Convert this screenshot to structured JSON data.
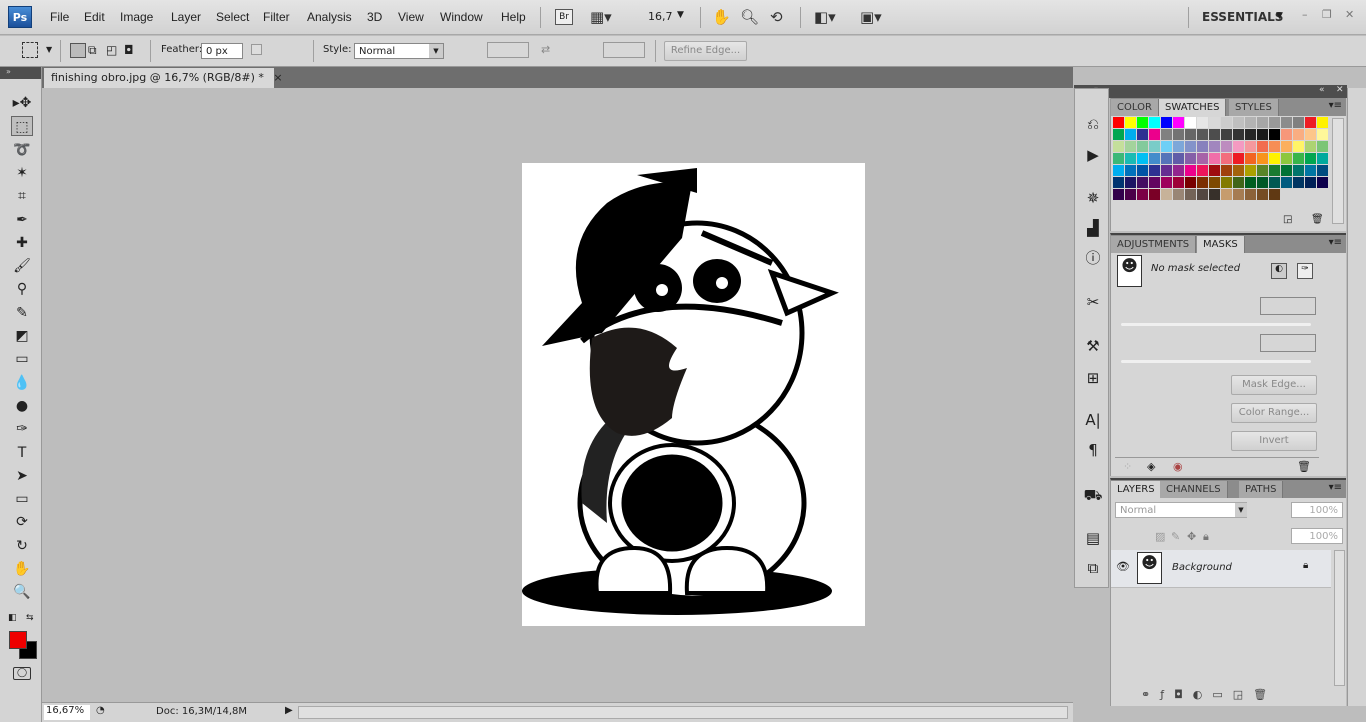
{
  "app": {
    "logo": "Ps",
    "menu": [
      "File",
      "Edit",
      "Image",
      "Layer",
      "Select",
      "Filter",
      "Analysis",
      "3D",
      "View",
      "Window",
      "Help"
    ],
    "bridge": "Br",
    "zoom": "16,7",
    "workspace": "ESSENTIALS",
    "window_controls": {
      "minimize": "–",
      "restore": "❐",
      "close": "✕"
    }
  },
  "options": {
    "feather_label": "Feather:",
    "feather_value": "0 px",
    "style_label": "Style:",
    "style_value": "Normal",
    "refine_edge": "Refine Edge..."
  },
  "document": {
    "tab_title": "finishing obro.jpg @ 16,7% (RGB/8#) *",
    "close": "×"
  },
  "tools": [
    {
      "name": "move-tool",
      "glyph": "▸✥"
    },
    {
      "name": "rectangular-marquee-tool",
      "glyph": "⬚",
      "selected": true
    },
    {
      "name": "lasso-tool",
      "glyph": "➰"
    },
    {
      "name": "magic-wand-tool",
      "glyph": "✶"
    },
    {
      "name": "crop-tool",
      "glyph": "⌗"
    },
    {
      "name": "eyedropper-tool",
      "glyph": "✒"
    },
    {
      "name": "healing-brush-tool",
      "glyph": "✚"
    },
    {
      "name": "brush-tool",
      "glyph": "🖌"
    },
    {
      "name": "clone-stamp-tool",
      "glyph": "⚲"
    },
    {
      "name": "history-brush-tool",
      "glyph": "✎"
    },
    {
      "name": "eraser-tool",
      "glyph": "◩"
    },
    {
      "name": "gradient-tool",
      "glyph": "▭"
    },
    {
      "name": "blur-tool",
      "glyph": "💧"
    },
    {
      "name": "dodge-tool",
      "glyph": "●"
    },
    {
      "name": "pen-tool",
      "glyph": "✑"
    },
    {
      "name": "type-tool",
      "glyph": "T"
    },
    {
      "name": "path-selection-tool",
      "glyph": "➤"
    },
    {
      "name": "rectangle-tool",
      "glyph": "▭"
    },
    {
      "name": "3d-rotate-tool",
      "glyph": "⟳"
    },
    {
      "name": "3d-orbit-tool",
      "glyph": "↻"
    },
    {
      "name": "hand-tool",
      "glyph": "✋"
    },
    {
      "name": "zoom-tool",
      "glyph": "🔍"
    }
  ],
  "colors": {
    "foreground": "#ee0000",
    "background": "#000000"
  },
  "panels": {
    "swatches_tabs": [
      "COLOR",
      "SWATCHES",
      "STYLES"
    ],
    "swatches": [
      [
        "#ff0000",
        "#ffff00",
        "#00ff00",
        "#00ffff",
        "#0000ff",
        "#ff00ff",
        "#ffffff",
        "#e6e6e6",
        "#d9d9d9",
        "#cccccc",
        "#bfbfbf",
        "#b3b3b3",
        "#a6a6a6",
        "#999999",
        "#8c8c8c",
        "#808080",
        "#ed1c24",
        "#fff200"
      ],
      [
        "#00a651",
        "#00aeef",
        "#2e3192",
        "#ec008c",
        "#808080",
        "#737373",
        "#666666",
        "#595959",
        "#4d4d4d",
        "#404040",
        "#333333",
        "#262626",
        "#1a1a1a",
        "#000000",
        "#f7977a",
        "#f9ad81",
        "#fdc68a",
        "#fff79a"
      ],
      [
        "#c4df9b",
        "#a3d39c",
        "#82ca9c",
        "#7accc8",
        "#6dcff6",
        "#7da7d9",
        "#8393ca",
        "#8781bd",
        "#a186be",
        "#bd8cbf",
        "#f49ac1",
        "#f5989d",
        "#f26c4f",
        "#f68e55",
        "#fbaf5d",
        "#fff467",
        "#acd372",
        "#7cc576"
      ],
      [
        "#3bb878",
        "#1abbb4",
        "#00bff3",
        "#438ccb",
        "#5574b9",
        "#605ca8",
        "#855fa8",
        "#a763a8",
        "#f06ea9",
        "#f26d7d",
        "#ed1c24",
        "#f26522",
        "#f7941d",
        "#fff200",
        "#8dc73f",
        "#39b54a",
        "#00a651",
        "#00a99d"
      ],
      [
        "#00aeef",
        "#0072bc",
        "#0054a6",
        "#2e3192",
        "#662d91",
        "#92278f",
        "#ec008c",
        "#ed145b",
        "#9e0b0f",
        "#a0410d",
        "#a3620a",
        "#aba000",
        "#598527",
        "#197b30",
        "#007236",
        "#00746b",
        "#0076a3",
        "#004b80"
      ],
      [
        "#003471",
        "#1b1464",
        "#440e62",
        "#630460",
        "#9e005d",
        "#9e0039",
        "#790000",
        "#7b2e00",
        "#7d4900",
        "#827b00",
        "#406618",
        "#005e20",
        "#005826",
        "#005952",
        "#005b7f",
        "#003663",
        "#002157",
        "#0d004c"
      ],
      [
        "#32004b",
        "#4b0049",
        "#7b0046",
        "#7a0026",
        "#c7b299",
        "#998675",
        "#736357",
        "#534741",
        "#37302a",
        "#c69c6d",
        "#a67c52",
        "#8c6239",
        "#754c24",
        "#603913"
      ]
    ],
    "adjust_tabs": [
      "ADJUSTMENTS",
      "MASKS"
    ],
    "masks": {
      "status": "No mask selected",
      "mask_edge": "Mask Edge...",
      "color_range": "Color Range...",
      "invert": "Invert"
    },
    "layers_tabs": [
      "LAYERS",
      "CHANNELS",
      "PATHS"
    ],
    "layers": {
      "blend_mode": "Normal",
      "opacity": "100%",
      "fill": "100%",
      "items": [
        {
          "name": "Background",
          "visible": true,
          "locked": true
        }
      ]
    }
  },
  "status": {
    "zoom": "16,67%",
    "doc": "Doc: 16,3M/14,8M"
  }
}
